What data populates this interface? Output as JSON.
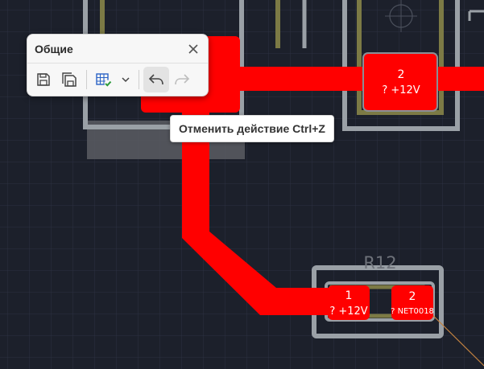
{
  "toolbar": {
    "title": "Общие",
    "buttons": [
      {
        "icon": "save-icon"
      },
      {
        "icon": "save-all-icon"
      },
      {
        "icon": "table-check-icon"
      },
      {
        "icon": "chevron-down-icon"
      },
      {
        "icon": "undo-icon",
        "state": "hovered"
      },
      {
        "icon": "redo-icon",
        "state": "disabled"
      }
    ]
  },
  "tooltip": {
    "text": "Отменить действие Ctrl+Z"
  },
  "board": {
    "pads": [
      {
        "number": "2",
        "net": "? +12V"
      },
      {
        "number": "1",
        "net": "? +12V"
      },
      {
        "number": "2",
        "net": "? NET0018"
      }
    ],
    "refdes": "R12"
  },
  "colors": {
    "background": "#1c202b",
    "trace": "#ff0000",
    "silkscreen": "#9aa0a6",
    "courtyard": "#7c7a45"
  }
}
